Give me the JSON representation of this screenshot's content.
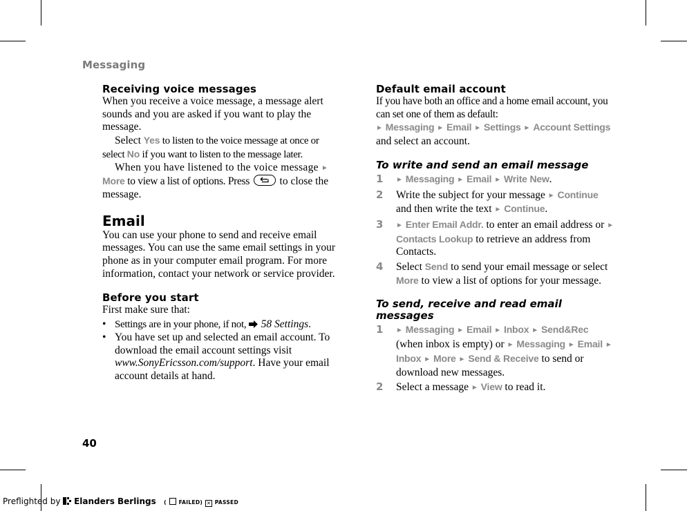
{
  "running_head": "Messaging",
  "page_number": "40",
  "left": {
    "receiving": {
      "heading": "Receiving voice messages",
      "intro": "When you receive a voice message, a message alert sounds and you are asked if you want to play the message.",
      "p2_a": "Select ",
      "p2_yes": "Yes",
      "p2_b": " to listen to the voice message at once or select ",
      "p2_no": "No",
      "p2_c": " if you want to listen to the message later.",
      "p3_a": "When you have listened to the voice message ",
      "p3_more": "More",
      "p3_b": " to view a list of options. Press ",
      "p3_key_icon": "back-key-icon",
      "p3_c": " to close the message."
    },
    "email": {
      "heading": "Email",
      "body": "You can use your phone to send and receive email messages. You can use the same email settings in your phone as in your computer email program. For more information, contact your network or service provider."
    },
    "before": {
      "heading": "Before you start",
      "intro": "First make sure that:",
      "bullet_char": "•",
      "b1_a": "Settings are in your phone, if not, ",
      "b1_ref_icon": "arrow-right-icon",
      "b1_ref": "58 Settings",
      "b1_end": ".",
      "b2_a": "You have set up and selected an email account. To download the email account settings visit ",
      "b2_url": "www.SonyEricsson.com/support",
      "b2_b": ". Have your email account details at hand."
    }
  },
  "right": {
    "default_account": {
      "heading": "Default email account",
      "body": "If you have both an office and a home email account, you can set one of them as default:",
      "path": [
        "Messaging",
        "Email",
        "Settings",
        "Account Settings"
      ],
      "after": "and select an account."
    },
    "write_send": {
      "heading": "To write and send an email message",
      "steps": [
        {
          "num": "1",
          "path": [
            "Messaging",
            "Email",
            "Write New"
          ],
          "end": "."
        },
        {
          "num": "2",
          "a": "Write the subject for your message ",
          "m1": "Continue",
          "b": " and then write the text ",
          "m2": "Continue",
          "end": "."
        },
        {
          "num": "3",
          "m1": "Enter Email Addr.",
          "a": " to enter an email address or ",
          "m2": "Contacts Lookup",
          "b": " to retrieve an address from Contacts."
        },
        {
          "num": "4",
          "a": "Select ",
          "m1": "Send",
          "b": " to send your email message or select ",
          "m2": "More",
          "c": " to view a list of options for your message."
        }
      ]
    },
    "send_receive": {
      "heading_l1": "To send, receive and read email",
      "heading_l2": "messages",
      "steps": [
        {
          "num": "1",
          "path1": [
            "Messaging",
            "Email",
            "Inbox",
            "Send&Rec"
          ],
          "a": " (when inbox is empty) or ",
          "path2": [
            "Messaging",
            "Email",
            "Inbox",
            "More",
            "Send & Receive"
          ],
          "b": " to send or download new messages."
        },
        {
          "num": "2",
          "a": "Select a message ",
          "m1": "View",
          "b": " to read it."
        }
      ]
    }
  },
  "footer": {
    "preflighted_by": "Preflighted by",
    "brand": "Elanders Berlings",
    "open_paren": "(",
    "failed": "FAILED",
    "close_paren": ")",
    "passed_mark": "✕",
    "passed": "PASSED"
  },
  "arrow_glyph": "►"
}
